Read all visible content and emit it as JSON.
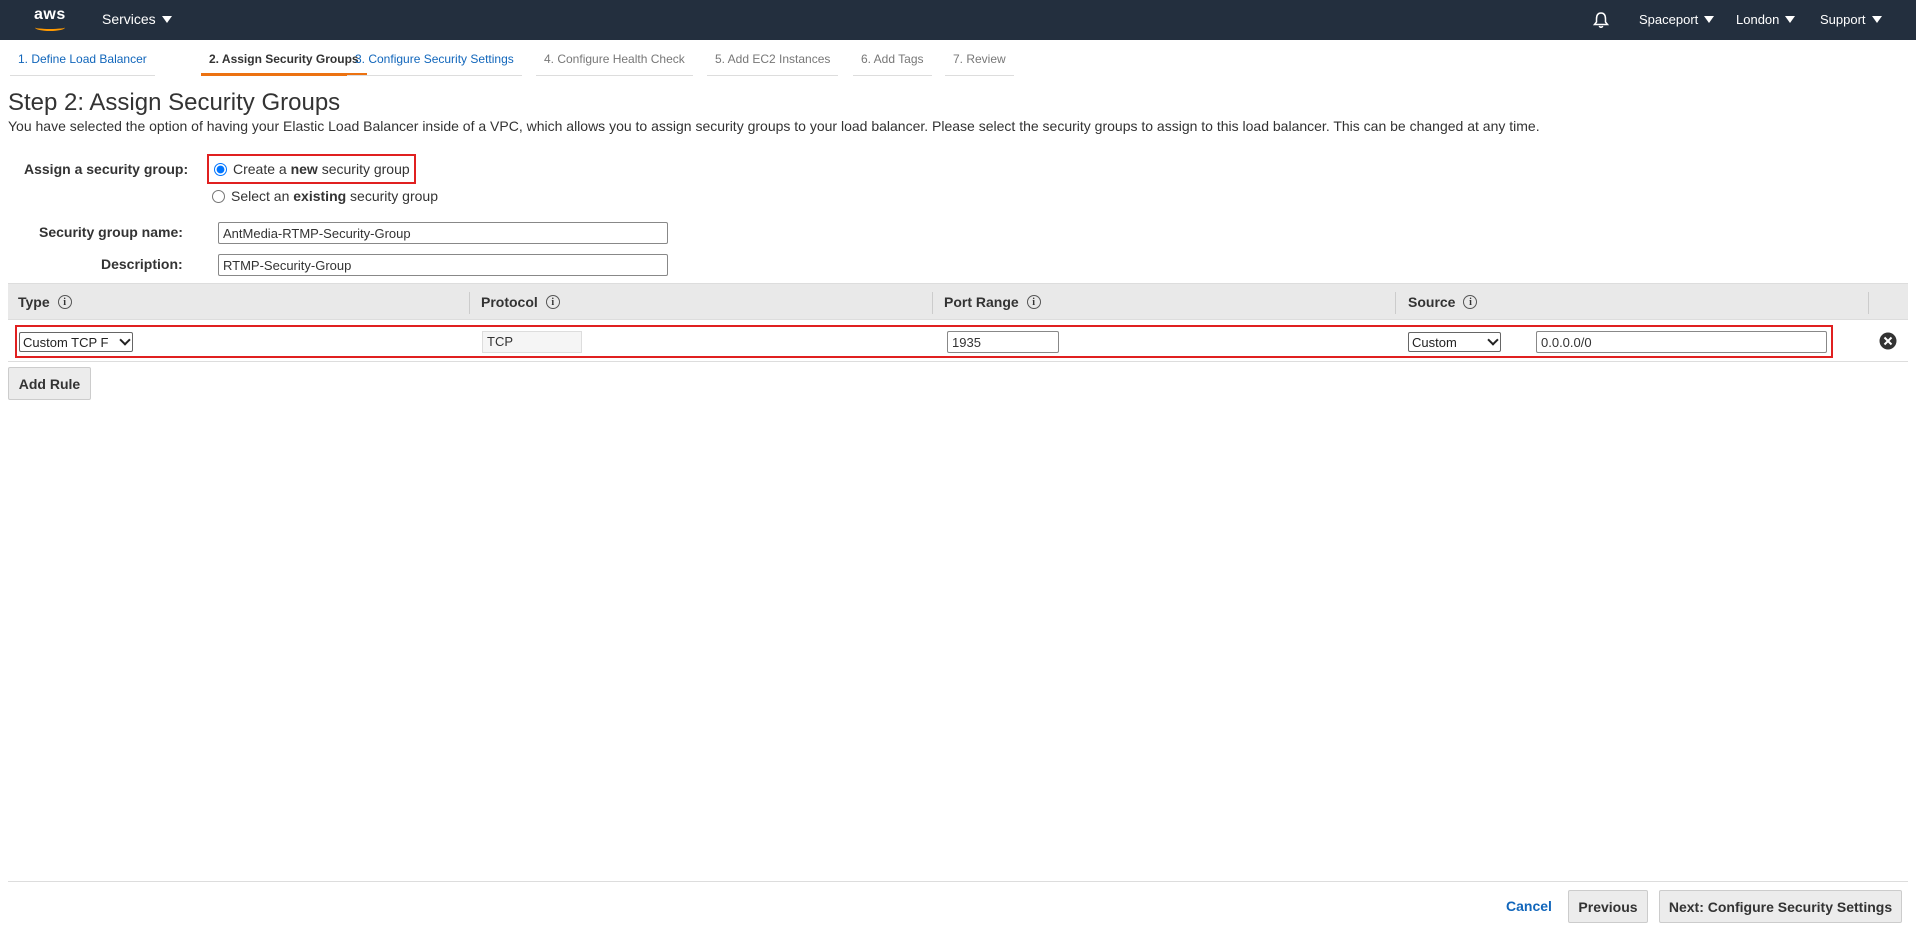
{
  "topnav": {
    "logo_text": "aws",
    "services": "Services",
    "account": "Spaceport",
    "region": "London",
    "support": "Support"
  },
  "wizard_steps": [
    {
      "label": "1. Define Load Balancer",
      "state": "link"
    },
    {
      "label": "2. Assign Security Groups",
      "state": "active"
    },
    {
      "label": "3. Configure Security Settings",
      "state": "link"
    },
    {
      "label": "4. Configure Health Check",
      "state": "disabled"
    },
    {
      "label": "5. Add EC2 Instances",
      "state": "disabled"
    },
    {
      "label": "6. Add Tags",
      "state": "disabled"
    },
    {
      "label": "7. Review",
      "state": "disabled"
    }
  ],
  "page": {
    "title": "Step 2: Assign Security Groups",
    "description": "You have selected the option of having your Elastic Load Balancer inside of a VPC, which allows you to assign security groups to your load balancer. Please select the security groups to assign to this load balancer. This can be changed at any time."
  },
  "form": {
    "assign_label": "Assign a security group:",
    "option_new_prefix": "Create a ",
    "option_new_bold": "new",
    "option_new_suffix": " security group",
    "option_existing_prefix": "Select an ",
    "option_existing_bold": "existing",
    "option_existing_suffix": " security group",
    "selected_option": "new",
    "name_label": "Security group name:",
    "name_value": "AntMedia-RTMP-Security-Group",
    "description_label": "Description:",
    "description_value": "RTMP-Security-Group"
  },
  "rules_table": {
    "headers": [
      "Type",
      "Protocol",
      "Port Range",
      "Source"
    ],
    "info_glyph": "i",
    "rows": [
      {
        "type": "Custom TCP F",
        "protocol": "TCP",
        "port_range": "1935",
        "source_type": "Custom",
        "source_value": "0.0.0.0/0"
      }
    ],
    "add_rule_label": "Add Rule"
  },
  "footer": {
    "cancel": "Cancel",
    "previous": "Previous",
    "next": "Next: Configure Security Settings"
  },
  "colors": {
    "nav_bg": "#232f3e",
    "accent": "#ec7211",
    "link": "#1166bb",
    "highlight": "#e02020"
  }
}
